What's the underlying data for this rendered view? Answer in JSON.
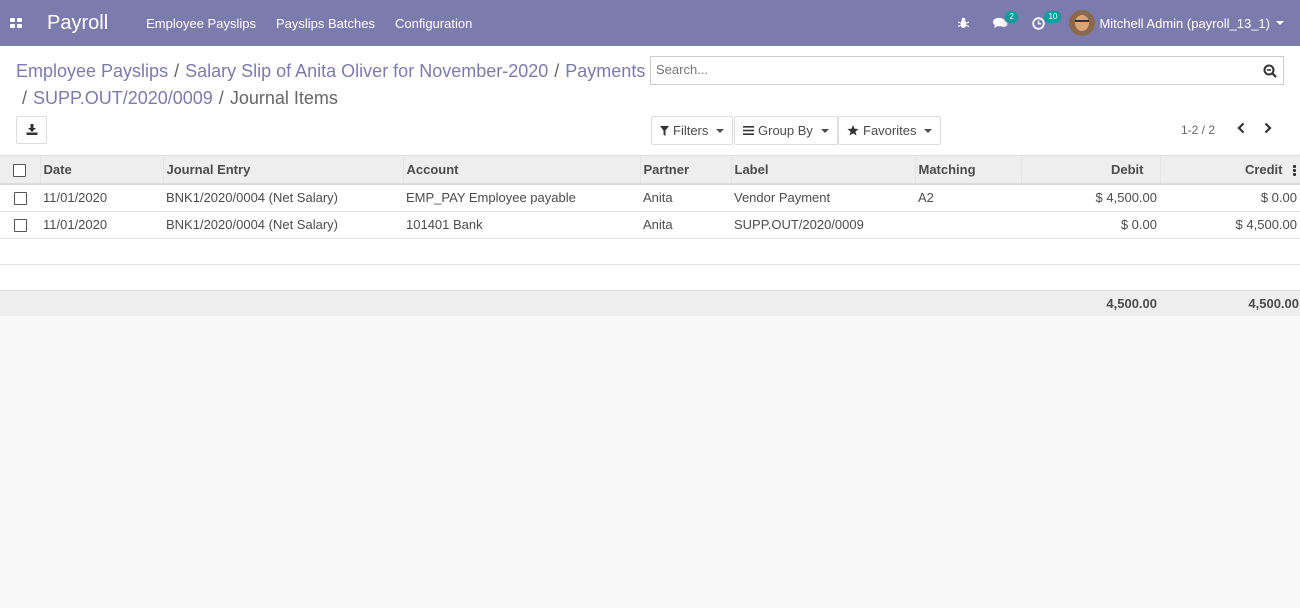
{
  "navbar": {
    "app_name": "Payroll",
    "menu": [
      "Employee Payslips",
      "Payslips Batches",
      "Configuration"
    ],
    "messages_count": "2",
    "activities_count": "10",
    "user_name": "Mitchell Admin (payroll_13_1)",
    "background_color": "#7c7bad"
  },
  "breadcrumb": {
    "items": [
      "Employee Payslips",
      "Salary Slip of Anita Oliver for November-2020",
      "Payments",
      "SUPP.OUT/2020/0009"
    ],
    "current": "Journal Items",
    "separator": "/"
  },
  "search": {
    "placeholder": "Search..."
  },
  "filters": {
    "filters_label": "Filters",
    "group_by_label": "Group By",
    "favorites_label": "Favorites"
  },
  "pager": {
    "value": "1-2 / 2"
  },
  "table": {
    "columns": {
      "date": "Date",
      "journal_entry": "Journal Entry",
      "account": "Account",
      "partner": "Partner",
      "label": "Label",
      "matching": "Matching",
      "debit": "Debit",
      "credit": "Credit"
    },
    "rows": [
      {
        "date": "11/01/2020",
        "journal_entry": "BNK1/2020/0004 (Net Salary)",
        "account": "EMP_PAY Employee payable",
        "partner": "Anita",
        "label": "Vendor Payment",
        "matching": "A2",
        "debit": "$ 4,500.00",
        "credit": "$ 0.00"
      },
      {
        "date": "11/01/2020",
        "journal_entry": "BNK1/2020/0004 (Net Salary)",
        "account": "101401 Bank",
        "partner": "Anita",
        "label": "SUPP.OUT/2020/0009",
        "matching": "",
        "debit": "$ 0.00",
        "credit": "$ 4,500.00"
      }
    ],
    "totals": {
      "debit": "4,500.00",
      "credit": "4,500.00"
    }
  }
}
